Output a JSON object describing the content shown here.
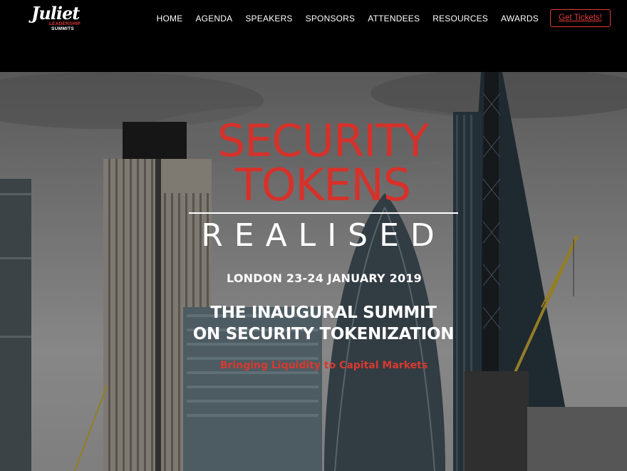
{
  "brand": {
    "logo_script": "Juliet",
    "logo_line1": "LEADERSHIP",
    "logo_line2": "SUMMITS"
  },
  "nav": {
    "items": [
      "HOME",
      "AGENDA",
      "SPEAKERS",
      "SPONSORS",
      "ATTENDEES",
      "RESOURCES",
      "AWARDS"
    ],
    "cta_label": "Get Tickets!"
  },
  "hero": {
    "title_line1": "SECURITY",
    "title_line2": "TOKENS",
    "subtitle": "REALISED",
    "date": "LONDON 23-24 JANUARY 2019",
    "summit_line1": "THE INAUGURAL SUMMIT",
    "summit_line2": "ON SECURITY TOKENIZATION",
    "tagline": "Bringing Liquidity to Capital Markets"
  },
  "colors": {
    "accent": "#d6312a",
    "header_bg": "#000000",
    "text": "#ffffff"
  }
}
